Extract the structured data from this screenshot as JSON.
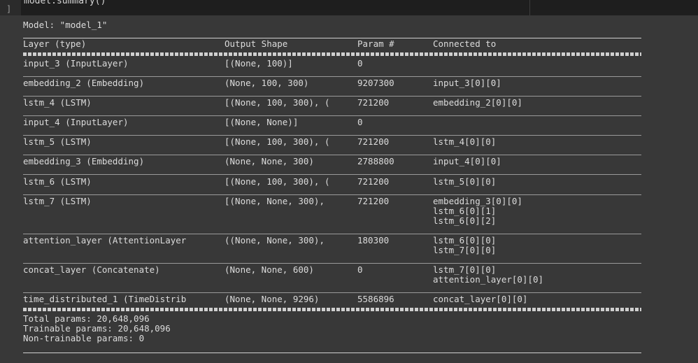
{
  "cell": {
    "code": "model.summary()",
    "output_marker": "]"
  },
  "summary": {
    "model_title": "Model: \"model_1\"",
    "headers": [
      "Layer (type)",
      "Output Shape",
      "Param #",
      "Connected to"
    ],
    "rows": [
      {
        "layer": "input_3 (InputLayer)",
        "shape": "[(None, 100)]",
        "params": "0",
        "connected": [
          ""
        ]
      },
      {
        "layer": "embedding_2 (Embedding)",
        "shape": "(None, 100, 300)",
        "params": "9207300",
        "connected": [
          "input_3[0][0]"
        ]
      },
      {
        "layer": "lstm_4 (LSTM)",
        "shape": "[(None, 100, 300), (",
        "params": "721200",
        "connected": [
          "embedding_2[0][0]"
        ]
      },
      {
        "layer": "input_4 (InputLayer)",
        "shape": "[(None, None)]",
        "params": "0",
        "connected": [
          ""
        ]
      },
      {
        "layer": "lstm_5 (LSTM)",
        "shape": "[(None, 100, 300), (",
        "params": "721200",
        "connected": [
          "lstm_4[0][0]"
        ]
      },
      {
        "layer": "embedding_3 (Embedding)",
        "shape": "(None, None, 300)",
        "params": "2788800",
        "connected": [
          "input_4[0][0]"
        ]
      },
      {
        "layer": "lstm_6 (LSTM)",
        "shape": "[(None, 100, 300), (",
        "params": "721200",
        "connected": [
          "lstm_5[0][0]"
        ]
      },
      {
        "layer": "lstm_7 (LSTM)",
        "shape": "[(None, None, 300),",
        "params": "721200",
        "connected": [
          "embedding_3[0][0]",
          "lstm_6[0][1]",
          "lstm_6[0][2]"
        ]
      },
      {
        "layer": "attention_layer (AttentionLayer",
        "shape": "((None, None, 300),",
        "params": "180300",
        "connected": [
          "lstm_6[0][0]",
          "lstm_7[0][0]"
        ]
      },
      {
        "layer": "concat_layer (Concatenate)",
        "shape": "(None, None, 600)",
        "params": "0",
        "connected": [
          "lstm_7[0][0]",
          "attention_layer[0][0]"
        ]
      },
      {
        "layer": "time_distributed_1 (TimeDistrib",
        "shape": "(None, None, 9296)",
        "params": "5586896",
        "connected": [
          "concat_layer[0][0]"
        ]
      }
    ],
    "total_params": "Total params: 20,648,096",
    "trainable_params": "Trainable params: 20,648,096",
    "non_trainable_params": "Non-trainable params: 0"
  }
}
